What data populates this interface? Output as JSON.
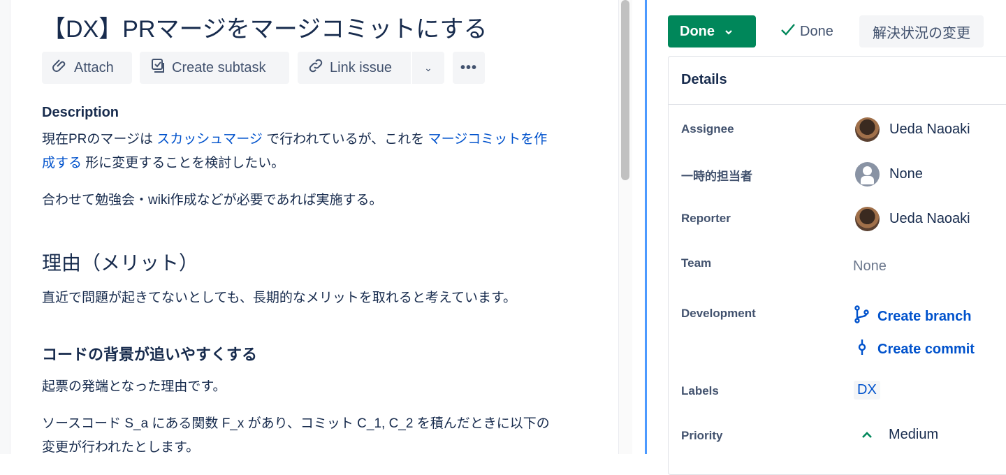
{
  "issue": {
    "title": "【DX】PRマージをマージコミットにする"
  },
  "toolbar": {
    "attach": "Attach",
    "create_subtask": "Create subtask",
    "link_issue": "Link issue"
  },
  "description": {
    "heading": "Description",
    "p1_a": "現在PRのマージは ",
    "p1_link1": "スカッシュマージ",
    "p1_b": " で行われているが、これを ",
    "p1_link2a": "マージコミットを作",
    "p1_link2b": "成する",
    "p1_c": " 形に変更することを検討したい。",
    "p2": "合わせて勉強会・wiki作成などが必要であれば実施する。",
    "h_reason": "理由（メリット）",
    "p3": "直近で問題が起きてないとしても、長期的なメリットを取れると考えています。",
    "h_code": "コードの背景が追いやすくする",
    "p4": "起票の発端となった理由です。",
    "p5a": "ソースコード S_a にある関数 F_x があり、コミット C_1, C_2 を積んだときに以下の",
    "p5b": "変更が行われたとします。"
  },
  "status": {
    "button": "Done",
    "resolved": "Done",
    "change_resolution": "解決状況の変更"
  },
  "details": {
    "heading": "Details",
    "assignee_label": "Assignee",
    "assignee": "Ueda Naoaki",
    "temp_label": "一時的担当者",
    "temp": "None",
    "reporter_label": "Reporter",
    "reporter": "Ueda Naoaki",
    "team_label": "Team",
    "team": "None",
    "dev_label": "Development",
    "create_branch": "Create branch",
    "create_commit": "Create commit",
    "labels_label": "Labels",
    "label_dx": "DX",
    "priority_label": "Priority",
    "priority": "Medium"
  },
  "colors": {
    "accent": "#0052cc",
    "done": "#00875a",
    "divider": "#4c9aff"
  }
}
